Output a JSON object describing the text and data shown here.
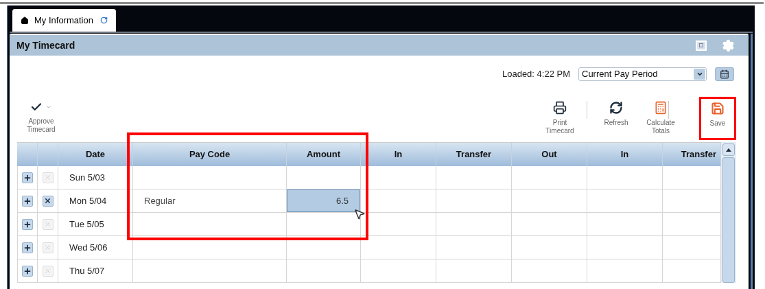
{
  "tab": {
    "label": "My Information",
    "selected": true
  },
  "panel": {
    "title": "My Timecard"
  },
  "loaded": "Loaded: 4:22 PM",
  "period_select": {
    "value": "Current Pay Period"
  },
  "toolbar": [
    {
      "kind": "approve",
      "label": "Approve Timecard",
      "highlighted": false
    },
    {
      "kind": "print",
      "label": "Print Timecard",
      "highlighted": false
    },
    {
      "kind": "refresh",
      "label": "Refresh",
      "highlighted": false
    },
    {
      "kind": "calculate",
      "label": "Calculate Totals",
      "highlighted": false
    },
    {
      "kind": "save",
      "label": "Save",
      "highlighted": true
    }
  ],
  "table": {
    "columns": [
      {
        "label": "Date",
        "highlighted": false
      },
      {
        "label": "Pay Code",
        "highlighted": true
      },
      {
        "label": "Amount",
        "highlighted": true
      },
      {
        "label": "In",
        "highlighted": false
      },
      {
        "label": "Transfer",
        "highlighted": false
      },
      {
        "label": "Out",
        "highlighted": false
      },
      {
        "label": "In",
        "highlighted": false
      },
      {
        "label": "Transfer",
        "highlighted": false
      }
    ],
    "rows": [
      {
        "date": "Sun 5/03",
        "delete_disabled": true,
        "highlighted": true
      },
      {
        "date": "Mon 5/04",
        "delete_disabled": false,
        "pay_code": "Regular",
        "amount": "6.5",
        "amount_selected": true,
        "highlighted": true
      },
      {
        "date": "Tue 5/05",
        "delete_disabled": true,
        "highlighted": true
      },
      {
        "date": "Wed 5/06",
        "delete_disabled": true,
        "highlighted": false
      },
      {
        "date": "Thu 5/07",
        "delete_disabled": true,
        "highlighted": false
      }
    ]
  }
}
